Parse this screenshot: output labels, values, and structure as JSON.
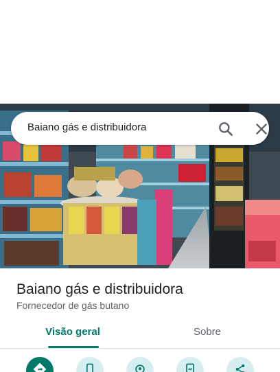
{
  "search": {
    "query": "Baiano gás e distribuidora",
    "search_icon": "search-icon",
    "close_icon": "close-icon"
  },
  "place": {
    "name": "Baiano gás e distribuidora",
    "category": "Fornecedor de gás butano"
  },
  "tabs": [
    {
      "label": "Visão geral",
      "selected": true
    },
    {
      "label": "Sobre",
      "selected": false
    }
  ],
  "actions": [
    {
      "icon": "directions-icon",
      "style": "primary"
    },
    {
      "icon": "phone-icon",
      "style": "secondary"
    },
    {
      "icon": "place-pin-icon",
      "style": "secondary"
    },
    {
      "icon": "save-icon",
      "style": "secondary"
    },
    {
      "icon": "share-icon",
      "style": "secondary"
    }
  ],
  "colors": {
    "accent": "#00796b",
    "action_secondary_bg": "#d7eef0",
    "text_primary": "#202124",
    "text_secondary": "#5f6368"
  }
}
